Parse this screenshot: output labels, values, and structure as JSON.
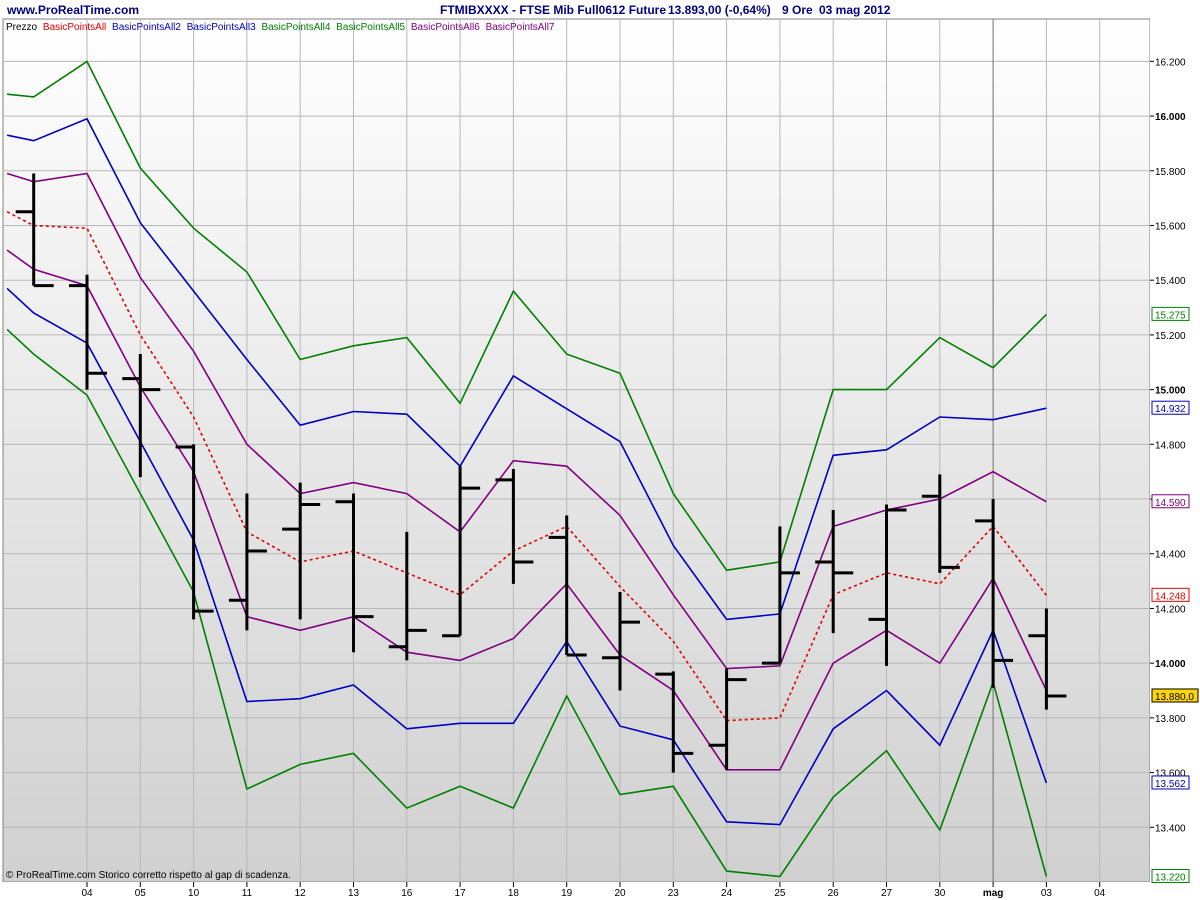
{
  "header": {
    "site": "www.ProRealTime.com",
    "instrument": "FTMIBXXXX - FTSE Mib Full0612 Future",
    "quote": "13.893,00 (-0,64%)",
    "period": "9 Ore",
    "date": "03 mag 2012"
  },
  "legend": {
    "items": [
      {
        "label": "Prezzo",
        "color": "#000000"
      },
      {
        "label": "BasicPointsAll",
        "color": "#e00000"
      },
      {
        "label": "BasicPointsAll2",
        "color": "#0000c0"
      },
      {
        "label": "BasicPointsAll3",
        "color": "#0000c0"
      },
      {
        "label": "BasicPointsAll4",
        "color": "#008000"
      },
      {
        "label": "BasicPointsAll5",
        "color": "#008000"
      },
      {
        "label": "BasicPointsAll6",
        "color": "#800080"
      },
      {
        "label": "BasicPointsAll7",
        "color": "#800080"
      }
    ]
  },
  "footer": {
    "note": "© ProRealTime.com  Storico corretto rispetto al gap di scadenza."
  },
  "chart_data": {
    "type": "line",
    "title": "FTMIBXXXX - FTSE Mib Full0612 Future",
    "ylim": [
      13200,
      16300
    ],
    "grid": true,
    "x_ticks": [
      "04",
      "05",
      "10",
      "11",
      "12",
      "13",
      "16",
      "17",
      "18",
      "19",
      "20",
      "23",
      "24",
      "25",
      "26",
      "27",
      "30",
      "mag",
      "03",
      "04"
    ],
    "y_ticks": [
      {
        "value": 13400,
        "label": "13.400",
        "bold": false
      },
      {
        "value": 13600,
        "label": "13.600",
        "bold": false
      },
      {
        "value": 13800,
        "label": "13.800",
        "bold": false
      },
      {
        "value": 14000,
        "label": "14.000",
        "bold": true
      },
      {
        "value": 14200,
        "label": "14.200",
        "bold": false
      },
      {
        "value": 14400,
        "label": "14.400",
        "bold": false
      },
      {
        "value": 14600,
        "label": "14.600",
        "bold": false
      },
      {
        "value": 14800,
        "label": "14.800",
        "bold": false
      },
      {
        "value": 15000,
        "label": "15.000",
        "bold": true
      },
      {
        "value": 15200,
        "label": "15.200",
        "bold": false
      },
      {
        "value": 15400,
        "label": "15.400",
        "bold": false
      },
      {
        "value": 15600,
        "label": "15.600",
        "bold": false
      },
      {
        "value": 15800,
        "label": "15.800",
        "bold": false
      },
      {
        "value": 16000,
        "label": "16.000",
        "bold": true
      },
      {
        "value": 16200,
        "label": "16.200",
        "bold": false
      }
    ],
    "value_labels": [
      {
        "text": "15.275",
        "value": 15275,
        "color": "#008000",
        "bg": "#ffffff"
      },
      {
        "text": "14.932",
        "value": 14932,
        "color": "#0000c0",
        "bg": "#ffffff"
      },
      {
        "text": "14.590",
        "value": 14590,
        "color": "#800080",
        "bg": "#ffffff"
      },
      {
        "text": "14.248",
        "value": 14248,
        "color": "#e00000",
        "bg": "#ffffff"
      },
      {
        "text": "13.880,0",
        "value": 13880,
        "color": "#000000",
        "bg": "#ffd700"
      },
      {
        "text": "13.562",
        "value": 13562,
        "color": "#0000c0",
        "bg": "#ffffff"
      },
      {
        "text": "13.220",
        "value": 13220,
        "color": "#008000",
        "bg": "#ffffff"
      }
    ],
    "series": [
      {
        "name": "BasicPointsAll",
        "color": "#e00000",
        "dashed": true,
        "points": [
          [
            -1.5,
            15650
          ],
          [
            -1,
            15600
          ],
          [
            0,
            15590
          ],
          [
            1,
            15200
          ],
          [
            2,
            14900
          ],
          [
            3,
            14480
          ],
          [
            4,
            14370
          ],
          [
            5,
            14410
          ],
          [
            6,
            14330
          ],
          [
            7,
            14250
          ],
          [
            8,
            14410
          ],
          [
            9,
            14500
          ],
          [
            10,
            14280
          ],
          [
            11,
            14080
          ],
          [
            12,
            13790
          ],
          [
            13,
            13800
          ],
          [
            14,
            14250
          ],
          [
            15,
            14330
          ],
          [
            16,
            14290
          ],
          [
            17,
            14500
          ],
          [
            18,
            14248
          ]
        ]
      },
      {
        "name": "BasicPointsAll2",
        "color": "#0000c0",
        "points": [
          [
            -1.5,
            15930
          ],
          [
            -1,
            15910
          ],
          [
            0,
            15990
          ],
          [
            1,
            15610
          ],
          [
            2,
            15360
          ],
          [
            3,
            15110
          ],
          [
            4,
            14870
          ],
          [
            5,
            14920
          ],
          [
            6,
            14910
          ],
          [
            7,
            14720
          ],
          [
            8,
            15050
          ],
          [
            9,
            14930
          ],
          [
            10,
            14810
          ],
          [
            11,
            14430
          ],
          [
            12,
            14160
          ],
          [
            13,
            14180
          ],
          [
            14,
            14760
          ],
          [
            15,
            14780
          ],
          [
            16,
            14900
          ],
          [
            17,
            14890
          ],
          [
            18,
            14932
          ]
        ]
      },
      {
        "name": "BasicPointsAll3",
        "color": "#0000c0",
        "points": [
          [
            -1.5,
            15370
          ],
          [
            -1,
            15280
          ],
          [
            0,
            15170
          ],
          [
            1,
            14810
          ],
          [
            2,
            14450
          ],
          [
            3,
            13860
          ],
          [
            4,
            13870
          ],
          [
            5,
            13920
          ],
          [
            6,
            13760
          ],
          [
            7,
            13780
          ],
          [
            8,
            13780
          ],
          [
            9,
            14080
          ],
          [
            10,
            13770
          ],
          [
            11,
            13720
          ],
          [
            12,
            13420
          ],
          [
            13,
            13410
          ],
          [
            14,
            13760
          ],
          [
            15,
            13900
          ],
          [
            16,
            13700
          ],
          [
            17,
            14120
          ],
          [
            18,
            13562
          ]
        ]
      },
      {
        "name": "BasicPointsAll4",
        "color": "#008000",
        "points": [
          [
            -1.5,
            16080
          ],
          [
            -1,
            16070
          ],
          [
            0,
            16200
          ],
          [
            1,
            15810
          ],
          [
            2,
            15590
          ],
          [
            3,
            15430
          ],
          [
            4,
            15110
          ],
          [
            5,
            15160
          ],
          [
            6,
            15190
          ],
          [
            7,
            14950
          ],
          [
            8,
            15360
          ],
          [
            9,
            15130
          ],
          [
            10,
            15060
          ],
          [
            11,
            14620
          ],
          [
            12,
            14340
          ],
          [
            13,
            14370
          ],
          [
            14,
            15000
          ],
          [
            15,
            15000
          ],
          [
            16,
            15190
          ],
          [
            17,
            15080
          ],
          [
            18,
            15275
          ]
        ]
      },
      {
        "name": "BasicPointsAll5",
        "color": "#008000",
        "points": [
          [
            -1.5,
            15220
          ],
          [
            -1,
            15130
          ],
          [
            0,
            14980
          ],
          [
            1,
            14620
          ],
          [
            2,
            14260
          ],
          [
            3,
            13540
          ],
          [
            4,
            13630
          ],
          [
            5,
            13670
          ],
          [
            6,
            13470
          ],
          [
            7,
            13550
          ],
          [
            8,
            13470
          ],
          [
            9,
            13880
          ],
          [
            10,
            13520
          ],
          [
            11,
            13550
          ],
          [
            12,
            13240
          ],
          [
            13,
            13220
          ],
          [
            14,
            13510
          ],
          [
            15,
            13680
          ],
          [
            16,
            13390
          ],
          [
            17,
            13930
          ],
          [
            18,
            13220
          ]
        ]
      },
      {
        "name": "BasicPointsAll6",
        "color": "#800080",
        "points": [
          [
            -1.5,
            15790
          ],
          [
            -1,
            15760
          ],
          [
            0,
            15790
          ],
          [
            1,
            15410
          ],
          [
            2,
            15140
          ],
          [
            3,
            14800
          ],
          [
            4,
            14620
          ],
          [
            5,
            14660
          ],
          [
            6,
            14620
          ],
          [
            7,
            14480
          ],
          [
            8,
            14740
          ],
          [
            9,
            14720
          ],
          [
            10,
            14540
          ],
          [
            11,
            14250
          ],
          [
            12,
            13980
          ],
          [
            13,
            13990
          ],
          [
            14,
            14500
          ],
          [
            15,
            14560
          ],
          [
            16,
            14600
          ],
          [
            17,
            14700
          ],
          [
            18,
            14590
          ]
        ]
      },
      {
        "name": "BasicPointsAll7",
        "color": "#800080",
        "points": [
          [
            -1.5,
            15510
          ],
          [
            -1,
            15440
          ],
          [
            0,
            15380
          ],
          [
            1,
            15010
          ],
          [
            2,
            14700
          ],
          [
            3,
            14170
          ],
          [
            4,
            14120
          ],
          [
            5,
            14170
          ],
          [
            6,
            14040
          ],
          [
            7,
            14010
          ],
          [
            8,
            14090
          ],
          [
            9,
            14290
          ],
          [
            10,
            14030
          ],
          [
            11,
            13900
          ],
          [
            12,
            13610
          ],
          [
            13,
            13610
          ],
          [
            14,
            14000
          ],
          [
            15,
            14120
          ],
          [
            16,
            14000
          ],
          [
            17,
            14310
          ],
          [
            18,
            13900
          ]
        ]
      }
    ],
    "ohlc": [
      {
        "x": -1,
        "open": 15650,
        "high": 15790,
        "low": 15380,
        "close": 15380
      },
      {
        "x": 0,
        "open": 15380,
        "high": 15420,
        "low": 15000,
        "close": 15060
      },
      {
        "x": 1,
        "open": 15040,
        "high": 15130,
        "low": 14680,
        "close": 15000
      },
      {
        "x": 2,
        "open": 14790,
        "high": 14800,
        "low": 14160,
        "close": 14190
      },
      {
        "x": 3,
        "open": 14230,
        "high": 14620,
        "low": 14120,
        "close": 14410
      },
      {
        "x": 4,
        "open": 14490,
        "high": 14660,
        "low": 14160,
        "close": 14580
      },
      {
        "x": 5,
        "open": 14590,
        "high": 14620,
        "low": 14040,
        "close": 14170
      },
      {
        "x": 6,
        "open": 14060,
        "high": 14480,
        "low": 14010,
        "close": 14120
      },
      {
        "x": 7,
        "open": 14100,
        "high": 14720,
        "low": 14100,
        "close": 14640
      },
      {
        "x": 8,
        "open": 14670,
        "high": 14710,
        "low": 14290,
        "close": 14370
      },
      {
        "x": 9,
        "open": 14460,
        "high": 14540,
        "low": 14030,
        "close": 14030
      },
      {
        "x": 10,
        "open": 14020,
        "high": 14260,
        "low": 13900,
        "close": 14150
      },
      {
        "x": 11,
        "open": 13960,
        "high": 13970,
        "low": 13600,
        "close": 13670
      },
      {
        "x": 12,
        "open": 13700,
        "high": 13980,
        "low": 13610,
        "close": 13940
      },
      {
        "x": 13,
        "open": 14000,
        "high": 14500,
        "low": 14000,
        "close": 14330
      },
      {
        "x": 14,
        "open": 14370,
        "high": 14560,
        "low": 14110,
        "close": 14330
      },
      {
        "x": 15,
        "open": 14160,
        "high": 14580,
        "low": 13990,
        "close": 14560
      },
      {
        "x": 16,
        "open": 14610,
        "high": 14690,
        "low": 14330,
        "close": 14350
      },
      {
        "x": 17,
        "open": 14520,
        "high": 14600,
        "low": 13910,
        "close": 14010
      },
      {
        "x": 18,
        "open": 14100,
        "high": 14200,
        "low": 13830,
        "close": 13880
      }
    ]
  }
}
